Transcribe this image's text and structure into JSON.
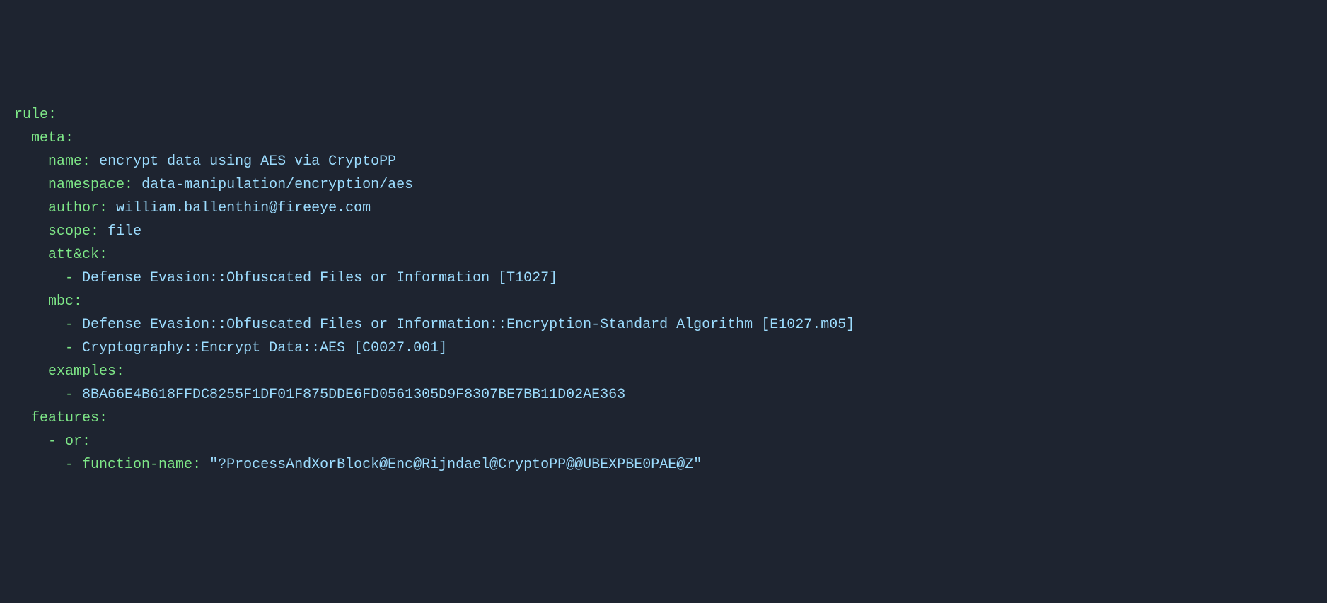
{
  "code": {
    "keys": {
      "rule": "rule",
      "meta": "meta",
      "name": "name",
      "namespace": "namespace",
      "author": "author",
      "scope": "scope",
      "attck": "att&ck",
      "mbc": "mbc",
      "examples": "examples",
      "features": "features",
      "or": "or",
      "function_name": "function-name"
    },
    "values": {
      "name": "encrypt data using AES via CryptoPP",
      "namespace": "data-manipulation/encryption/aes",
      "author": "william.ballenthin@fireeye.com",
      "scope": "file",
      "attck_item": "Defense Evasion::Obfuscated Files or Information [T1027]",
      "mbc_item1": "Defense Evasion::Obfuscated Files or Information::Encryption-Standard Algorithm [E1027.m05]",
      "mbc_item2": "Cryptography::Encrypt Data::AES [C0027.001]",
      "example_hash": "8BA66E4B618FFDC8255F1DF01F875DDE6FD0561305D9F8307BE7BB11D02AE363",
      "function_name_value": "\"?ProcessAndXorBlock@Enc@Rijndael@CryptoPP@@UBEXPBE0PAE@Z\""
    },
    "punctuation": {
      "colon": ":",
      "dash": "- "
    }
  }
}
